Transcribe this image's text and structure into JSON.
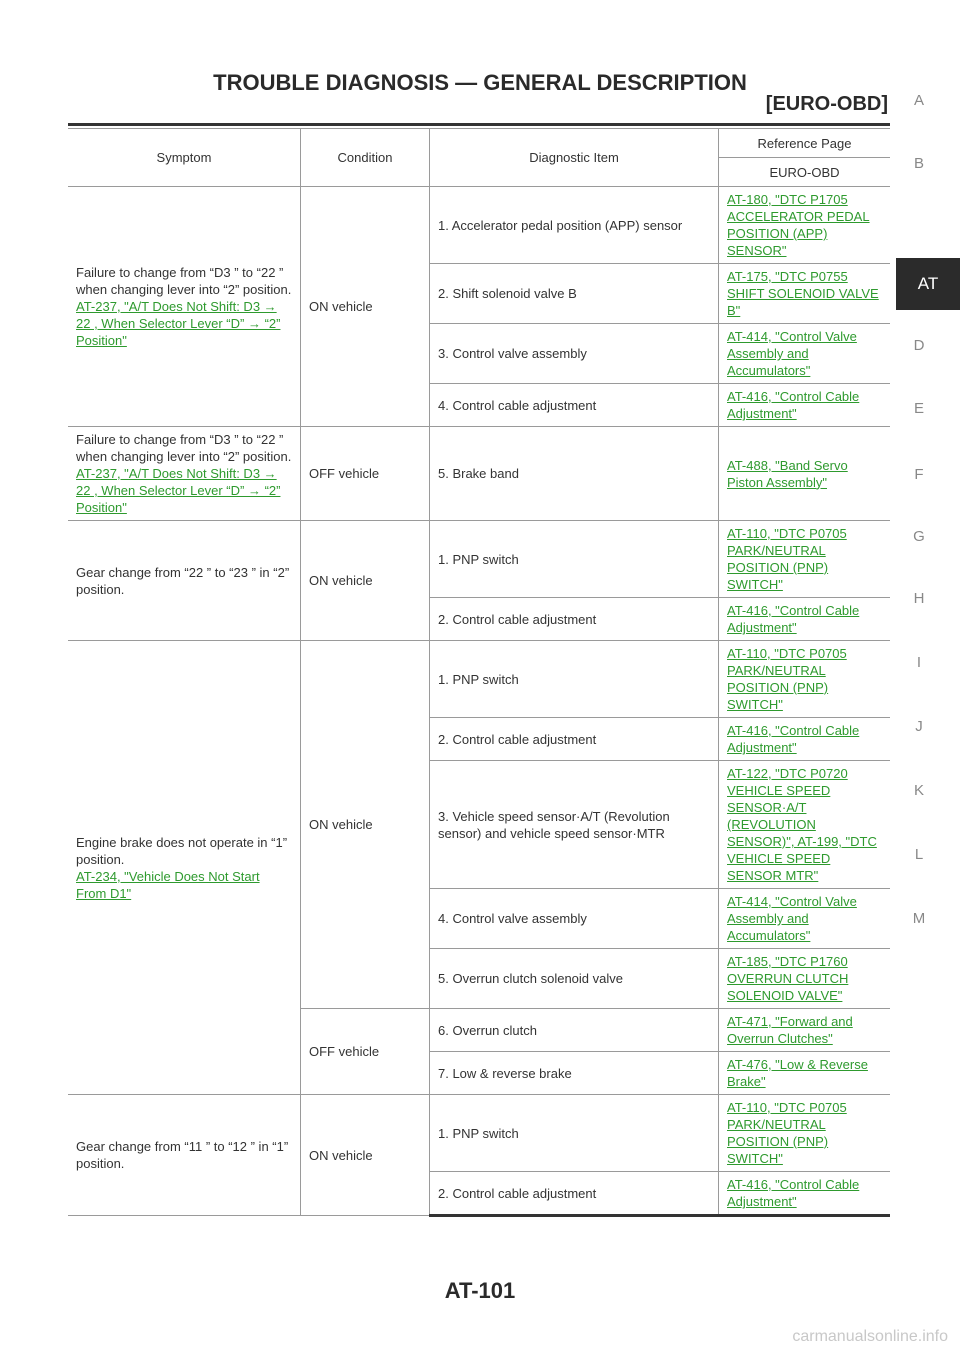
{
  "header": {
    "title": "TROUBLE DIAGNOSIS — GENERAL DESCRIPTION",
    "subtitle": "[EURO-OBD]"
  },
  "side_tabs": [
    "A",
    "B",
    "AT",
    "D",
    "E",
    "F",
    "G",
    "H",
    "I",
    "J",
    "K",
    "L",
    "M"
  ],
  "side_tab_active": "AT",
  "table": {
    "headers": {
      "symptom": "Symptom",
      "condition": "Condition",
      "diagnostic_item": "Diagnostic Item",
      "reference_page": "Reference Page",
      "reference_sub": "EURO-OBD"
    },
    "groups": [
      {
        "symptom": "Failure to change from “D3 ” to “22 ” when changing lever into “2” position.",
        "symptom_link": "AT-237, \"A/T Does Not Shift: D3 → 22 , When Selector Lever “D” → “2” Position\"",
        "conditions": [
          {
            "condition": "ON vehicle",
            "items": [
              {
                "item": "1. Accelerator pedal position (APP) sensor",
                "ref": "AT-180, \"DTC P1705 ACCELERATOR PEDAL POSITION (APP) SENSOR\""
              },
              {
                "item": "2. Shift solenoid valve B",
                "ref": "AT-175, \"DTC P0755 SHIFT SOLENOID VALVE B\""
              },
              {
                "item": "3. Control valve assembly",
                "ref": "AT-414, \"Control Valve Assembly and Accumulators\""
              },
              {
                "item": "4. Control cable adjustment",
                "ref": "AT-416, \"Control Cable Adjustment\""
              }
            ]
          }
        ]
      },
      {
        "symptom": "Failure to change from “D3 ” to “22 ” when changing lever into “2” position.",
        "symptom_link": "AT-237, \"A/T Does Not Shift: D3 → 22 , When Selector Lever “D” → “2” Position\"",
        "conditions": [
          {
            "condition": "OFF vehicle",
            "items": [
              {
                "item": "5. Brake band",
                "ref": "AT-488, \"Band Servo Piston Assembly\""
              }
            ]
          }
        ]
      },
      {
        "symptom": "Gear change from “22 ” to “23 ” in “2” position.",
        "symptom_link": "",
        "conditions": [
          {
            "condition": "ON vehicle",
            "items": [
              {
                "item": "1. PNP switch",
                "ref": "AT-110, \"DTC P0705 PARK/NEUTRAL POSITION (PNP) SWITCH\""
              },
              {
                "item": "2. Control cable adjustment",
                "ref": "AT-416, \"Control Cable Adjustment\""
              }
            ]
          }
        ]
      },
      {
        "symptom": "Engine brake does not operate in “1” position.",
        "symptom_link": "AT-234, \"Vehicle Does Not Start From D1\"",
        "conditions": [
          {
            "condition": "ON vehicle",
            "items": [
              {
                "item": "1. PNP switch",
                "ref": "AT-110, \"DTC P0705 PARK/NEUTRAL POSITION (PNP) SWITCH\""
              },
              {
                "item": "2. Control cable adjustment",
                "ref": "AT-416, \"Control Cable Adjustment\""
              },
              {
                "item": "3. Vehicle speed sensor·A/T (Revolution sensor) and vehicle speed sensor·MTR",
                "ref": "AT-122, \"DTC P0720 VEHICLE SPEED SENSOR·A/T (REVOLUTION SENSOR)\", AT-199, \"DTC VEHICLE SPEED SENSOR MTR\""
              },
              {
                "item": "4. Control valve assembly",
                "ref": "AT-414, \"Control Valve Assembly and Accumulators\""
              },
              {
                "item": "5. Overrun clutch solenoid valve",
                "ref": "AT-185, \"DTC P1760 OVERRUN CLUTCH SOLENOID VALVE\""
              }
            ]
          },
          {
            "condition": "OFF vehicle",
            "items": [
              {
                "item": "6. Overrun clutch",
                "ref": "AT-471, \"Forward and Overrun Clutches\""
              },
              {
                "item": "7. Low & reverse brake",
                "ref": "AT-476, \"Low & Reverse Brake\""
              }
            ]
          }
        ]
      },
      {
        "symptom": "Gear change from “11 ” to “12 ” in “1” position.",
        "symptom_link": "",
        "conditions": [
          {
            "condition": "ON vehicle",
            "items": [
              {
                "item": "1. PNP switch",
                "ref": "AT-110, \"DTC P0705 PARK/NEUTRAL POSITION (PNP) SWITCH\""
              },
              {
                "item": "2. Control cable adjustment",
                "ref": "AT-416, \"Control Cable Adjustment\""
              }
            ]
          }
        ]
      }
    ]
  },
  "footer": {
    "page_number": "AT-101"
  },
  "watermark": "carmanualsonline.info",
  "colors": {
    "link": "#2e9a2e",
    "text": "#333333",
    "active_tab_bg": "#2b2b2b"
  }
}
